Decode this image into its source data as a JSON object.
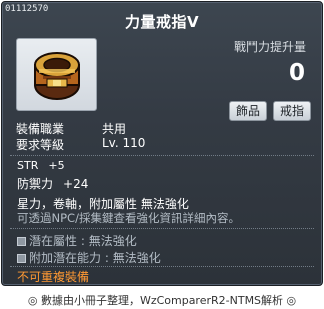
{
  "item": {
    "id": "01112570",
    "title": "力量戒指Ⅴ",
    "icon": "ring-icon",
    "combat_power_label": "戰鬥力提升量",
    "combat_power_value": "0",
    "tags": [
      "飾品",
      "戒指"
    ]
  },
  "requirements": {
    "job_label": "裝備職業",
    "job_value": "共用",
    "level_label": "要求等級",
    "level_value": "Lv. 110"
  },
  "stats": [
    {
      "label": "STR",
      "value": "+5"
    },
    {
      "label": "防禦力",
      "value": "+24"
    }
  ],
  "description": {
    "flags": "星力，卷軸，附加屬性 無法強化",
    "note": "可透過NPC/採集鍵查看強化資訊詳細內容。"
  },
  "potential": {
    "line1_label": "潛在屬性",
    "line1_value": "無法強化",
    "line2_label": "附加潛在能力",
    "line2_value": "無法強化"
  },
  "warning": "不可重複裝備",
  "footer": "◎ 數據由小冊子整理，WzComparerR2-NTMS解析 ◎",
  "colors": {
    "tooltip_bg": "#353c45",
    "warning": "#ff9933",
    "muted_text": "#b3bcc5"
  }
}
